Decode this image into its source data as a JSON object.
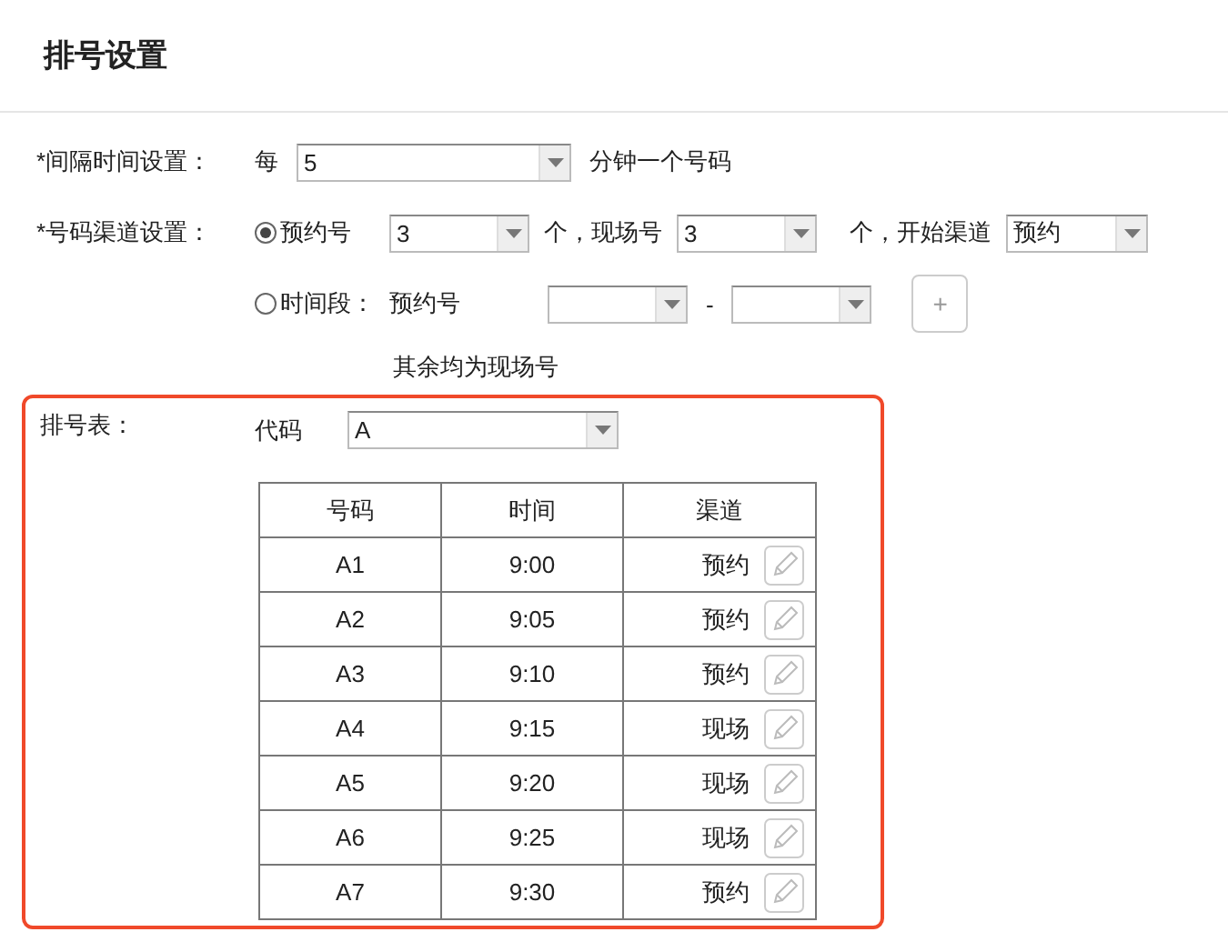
{
  "title": "排号设置",
  "interval": {
    "label": "*间隔时间设置：",
    "prefix": "每",
    "value": "5",
    "suffix": "分钟一个号码"
  },
  "channel": {
    "label": "*号码渠道设置：",
    "count_option": {
      "selected": true,
      "label": "预约号",
      "reserved_count": "3",
      "text_1": "个，现场号",
      "walkin_count": "3",
      "text_2": "个，开始渠道",
      "start_channel": "预约"
    },
    "period_option": {
      "selected": false,
      "label": "时间段：",
      "sub_label": "预约号",
      "separator": "-",
      "add_button": "+"
    },
    "note": "其余均为现场号"
  },
  "schedule": {
    "label": "排号表：",
    "code_label": "代码",
    "code_value": "A",
    "columns": [
      "号码",
      "时间",
      "渠道"
    ],
    "rows": [
      {
        "number": "A1",
        "time": "9:00",
        "channel": "预约"
      },
      {
        "number": "A2",
        "time": "9:05",
        "channel": "预约"
      },
      {
        "number": "A3",
        "time": "9:10",
        "channel": "预约"
      },
      {
        "number": "A4",
        "time": "9:15",
        "channel": "现场"
      },
      {
        "number": "A5",
        "time": "9:20",
        "channel": "现场"
      },
      {
        "number": "A6",
        "time": "9:25",
        "channel": "现场"
      },
      {
        "number": "A7",
        "time": "9:30",
        "channel": "预约"
      }
    ]
  }
}
